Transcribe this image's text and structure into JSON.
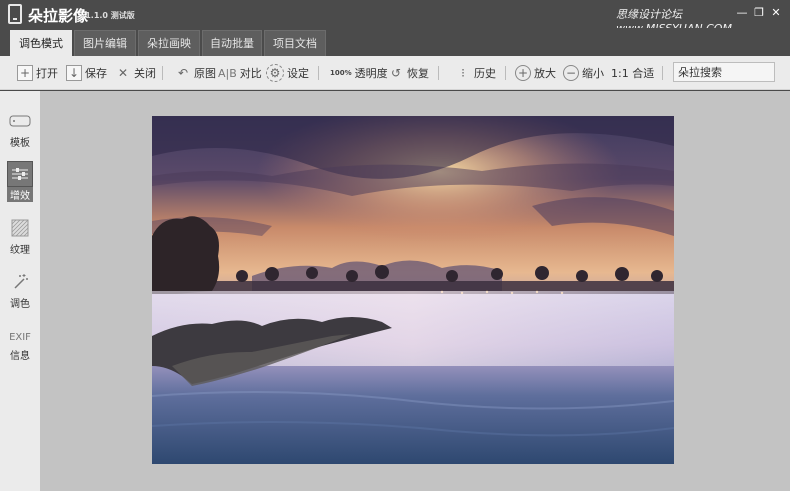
{
  "app": {
    "title": "朵拉影像",
    "version": "v1.1.0 测试版",
    "watermark": "思缘设计论坛 www.MISSYUAN.COM"
  },
  "window_controls": {
    "minimize": "—",
    "restore": "❐",
    "close": "✕"
  },
  "tabs": [
    {
      "label": "调色模式",
      "active": true
    },
    {
      "label": "图片编辑",
      "active": false
    },
    {
      "label": "朵拉画映",
      "active": false
    },
    {
      "label": "自动批量",
      "active": false
    },
    {
      "label": "项目文档",
      "active": false
    }
  ],
  "toolbar": {
    "open": "打开",
    "save": "保存",
    "close": "关闭",
    "original": "原图",
    "ab_icon_text": "A|B",
    "compare": "对比",
    "settings": "设定",
    "opacity_icon_text": "100%",
    "opacity": "透明度",
    "restore": "恢复",
    "history": "历史",
    "zoom_in": "放大",
    "zoom_out": "缩小",
    "fit": "1:1 合适",
    "search_value": "朵拉搜索"
  },
  "sidebar": {
    "items": [
      {
        "label": "模板",
        "icon": "tag-icon",
        "active": false
      },
      {
        "label": "增效",
        "icon": "sliders-icon",
        "active": true
      },
      {
        "label": "纹理",
        "icon": "texture-icon",
        "active": false
      },
      {
        "label": "调色",
        "icon": "magic-wand-icon",
        "active": false
      },
      {
        "label": "信息",
        "icon_text": "EXIF",
        "icon": "exif-icon",
        "active": false
      }
    ]
  },
  "colors": {
    "titlebar": "#4b4b4b",
    "toolbar": "#ebebeb",
    "canvas": "#c3c3c3",
    "active_tool": "#777777"
  }
}
